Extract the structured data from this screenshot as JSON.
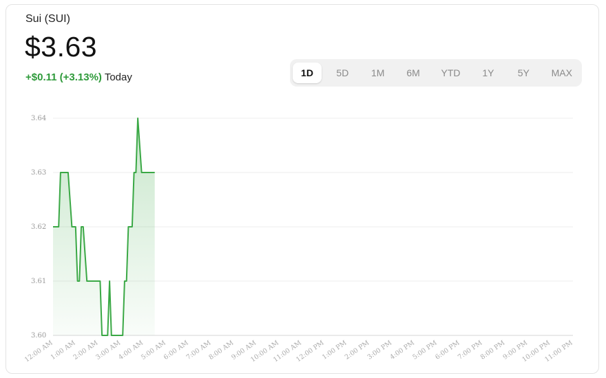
{
  "header": {
    "asset_name": "Sui (SUI)",
    "price": "$3.63",
    "change": "+$0.11 (+3.13%)",
    "period_label": "Today"
  },
  "range_tabs": [
    {
      "label": "1D",
      "active": true
    },
    {
      "label": "5D",
      "active": false
    },
    {
      "label": "1M",
      "active": false
    },
    {
      "label": "6M",
      "active": false
    },
    {
      "label": "YTD",
      "active": false
    },
    {
      "label": "1Y",
      "active": false
    },
    {
      "label": "5Y",
      "active": false
    },
    {
      "label": "MAX",
      "active": false
    }
  ],
  "colors": {
    "line": "#3aa845",
    "positive": "#2e9a3a",
    "grid": "#ececec"
  },
  "chart_data": {
    "type": "area",
    "title": "",
    "xlabel": "",
    "ylabel": "",
    "ylim": [
      3.6,
      3.64
    ],
    "yticks": [
      "3.60",
      "3.61",
      "3.62",
      "3.63",
      "3.64"
    ],
    "xlim": [
      "12:00 AM",
      "11:00 PM"
    ],
    "xticks": [
      "12:00 AM",
      "1:00 AM",
      "2:00 AM",
      "3:00 AM",
      "4:00 AM",
      "5:00 AM",
      "6:00 AM",
      "7:00 AM",
      "8:00 AM",
      "9:00 AM",
      "10:00 AM",
      "11:00 AM",
      "12:00 PM",
      "1:00 PM",
      "2:00 PM",
      "3:00 PM",
      "4:00 PM",
      "5:00 PM",
      "6:00 PM",
      "7:00 PM",
      "8:00 PM",
      "9:00 PM",
      "10:00 PM",
      "11:00 PM"
    ],
    "grid": true,
    "series": [
      {
        "x": [
          "12:00 AM",
          "12:15 AM",
          "12:20 AM",
          "12:40 AM",
          "12:50 AM",
          "1:00 AM",
          "1:05 AM",
          "1:10 AM",
          "1:15 AM",
          "1:20 AM",
          "1:30 AM",
          "1:35 AM",
          "2:05 AM",
          "2:10 AM",
          "2:25 AM",
          "2:30 AM",
          "2:35 AM",
          "2:40 AM",
          "3:05 AM",
          "3:10 AM",
          "3:15 AM",
          "3:20 AM",
          "3:30 AM",
          "3:35 AM",
          "3:40 AM",
          "3:45 AM",
          "3:55 AM",
          "4:00 AM",
          "4:05 AM",
          "4:10 AM",
          "4:15 AM",
          "4:30 AM"
        ],
        "y": [
          3.62,
          3.62,
          3.63,
          3.63,
          3.62,
          3.62,
          3.61,
          3.61,
          3.62,
          3.62,
          3.61,
          3.61,
          3.61,
          3.6,
          3.6,
          3.61,
          3.6,
          3.6,
          3.6,
          3.61,
          3.61,
          3.62,
          3.62,
          3.63,
          3.63,
          3.64,
          3.63,
          3.63,
          3.63,
          3.63,
          3.63,
          3.63
        ]
      }
    ]
  }
}
